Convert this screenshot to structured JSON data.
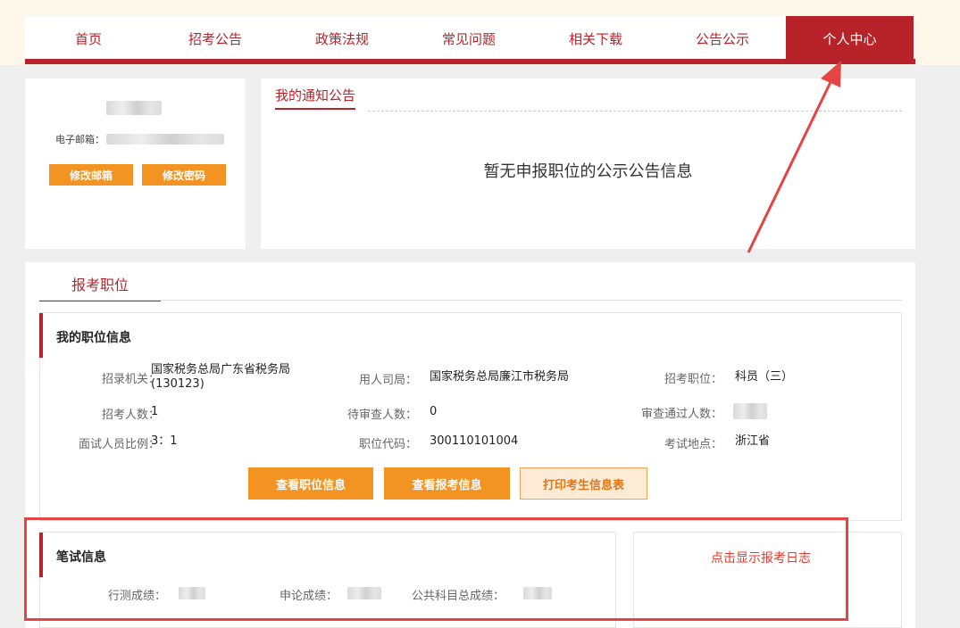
{
  "nav": {
    "items": [
      "首页",
      "招考公告",
      "政策法规",
      "常见问题",
      "相关下载",
      "公告公示",
      "个人中心"
    ]
  },
  "profile": {
    "email_label": "电子邮箱：",
    "change_email": "修改邮箱",
    "change_password": "修改密码"
  },
  "notice": {
    "title": "我的通知公告",
    "empty_text": "暂无申报职位的公示公告信息"
  },
  "tab": {
    "label": "报考职位"
  },
  "position": {
    "title": "我的职位信息",
    "recruiting_org_label": "招录机关：",
    "recruiting_org_value": "国家税务总局广东省税务局(130123)",
    "employer_label": "用人司局：",
    "employer_value": "国家税务总局廉江市税务局",
    "post_label": "招考职位：",
    "post_value": "科员（三）",
    "headcount_label": "招考人数：",
    "headcount_value": "1",
    "pending_label": "待审查人数：",
    "pending_value": "0",
    "approved_label": "审查通过人数：",
    "ratio_label": "面试人员比例：",
    "ratio_value": "3：1",
    "code_label": "职位代码：",
    "code_value": "300110101004",
    "location_label": "考试地点：",
    "location_value": "浙江省",
    "btn_view_post": "查看职位信息",
    "btn_view_application": "查看报考信息",
    "btn_print": "打印考生信息表"
  },
  "exam": {
    "title": "笔试信息",
    "xingce_label": "行测成绩：",
    "shenlun_label": "申论成绩：",
    "total_label": "公共科目总成绩："
  },
  "log": {
    "link": "点击显示报考日志"
  },
  "colors": {
    "brand_red": "#b8232a",
    "orange": "#f39322",
    "annotation_red": "#e54444"
  }
}
